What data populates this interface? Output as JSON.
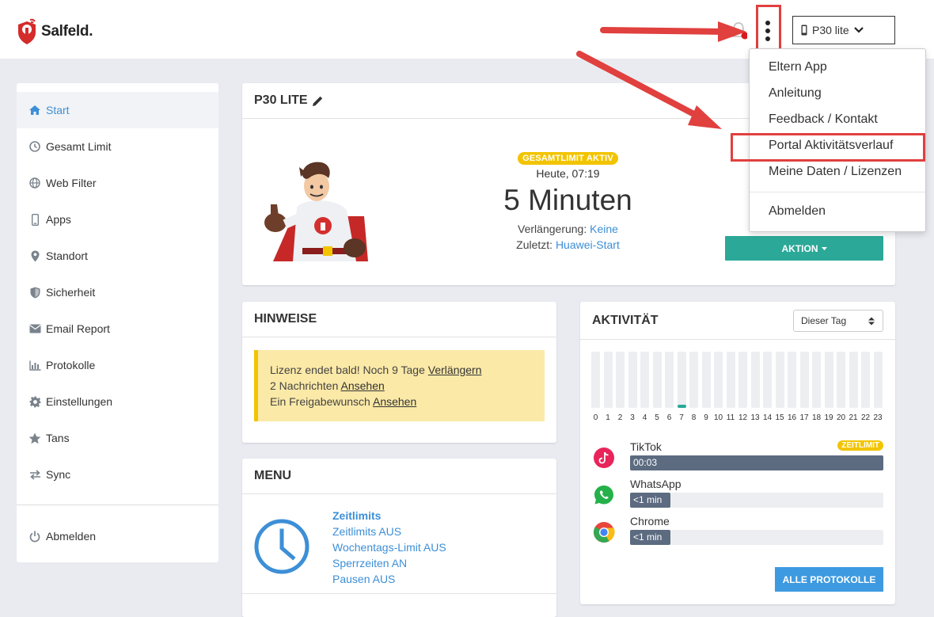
{
  "header": {
    "brand": "Salfeld.",
    "device_label": "P30 lite"
  },
  "dropdown": {
    "items": [
      "Eltern App",
      "Anleitung",
      "Feedback / Kontakt",
      "Portal Aktivitätsverlauf",
      "Meine Daten / Lizenzen"
    ],
    "logout": "Abmelden"
  },
  "sidebar": {
    "items": [
      {
        "label": "Start",
        "icon": "home-icon"
      },
      {
        "label": "Gesamt Limit",
        "icon": "clock-icon"
      },
      {
        "label": "Web Filter",
        "icon": "globe-icon"
      },
      {
        "label": "Apps",
        "icon": "phone-icon"
      },
      {
        "label": "Standort",
        "icon": "map-marker-icon"
      },
      {
        "label": "Sicherheit",
        "icon": "shield-icon"
      },
      {
        "label": "Email Report",
        "icon": "envelope-icon"
      },
      {
        "label": "Protokolle",
        "icon": "bar-chart-icon"
      },
      {
        "label": "Einstellungen",
        "icon": "gear-icon"
      },
      {
        "label": "Tans",
        "icon": "star-icon"
      },
      {
        "label": "Sync",
        "icon": "exchange-icon"
      }
    ],
    "logout": "Abmelden"
  },
  "device_card": {
    "title": "P30 LITE",
    "badge": "GESAMTLIMIT AKTIV",
    "time": "Heute, 07:19",
    "remaining": "5 Minuten",
    "extension_label": "Verlängerung:",
    "extension_value": "Keine",
    "last_label": "Zuletzt:",
    "last_value": "Huawei-Start",
    "action_button": "AKTION"
  },
  "hinweise": {
    "title": "HINWEISE",
    "line1_text": "Lizenz endet bald! Noch 9 Tage",
    "line1_link": "Verlängern",
    "line2_text": "2 Nachrichten",
    "line2_link": "Ansehen",
    "line3_text": "Ein Freigabewunsch",
    "line3_link": "Ansehen"
  },
  "menu": {
    "title": "MENU",
    "heading": "Zeitlimits",
    "items": [
      "Zeitlimits AUS",
      "Wochentags-Limit AUS",
      "Sperrzeiten AN",
      "Pausen AUS"
    ]
  },
  "activity": {
    "title": "AKTIVITÄT",
    "period": "Dieser Tag",
    "hours": [
      "0",
      "1",
      "2",
      "3",
      "4",
      "5",
      "6",
      "7",
      "8",
      "9",
      "10",
      "11",
      "12",
      "13",
      "14",
      "15",
      "16",
      "17",
      "18",
      "19",
      "20",
      "21",
      "22",
      "23"
    ],
    "active_hour": "7",
    "apps": [
      {
        "name": "TikTok",
        "usage": "00:03",
        "badge": "ZEITLIMIT",
        "fill": 1.0
      },
      {
        "name": "WhatsApp",
        "usage": "<1 min",
        "badge": "",
        "fill": 0.16
      },
      {
        "name": "Chrome",
        "usage": "<1 min",
        "badge": "",
        "fill": 0.16
      }
    ],
    "all_logs_button": "ALLE PROTOKOLLE"
  },
  "colors": {
    "accent_blue": "#3d8fd6",
    "teal": "#2ba898",
    "yellow": "#f2c400",
    "highlight_red": "#e0403e"
  }
}
